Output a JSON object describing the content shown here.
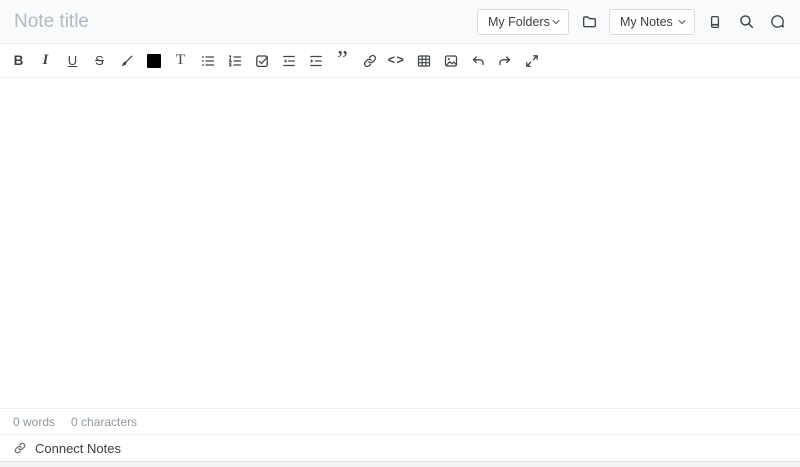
{
  "header": {
    "title_placeholder": "Note title",
    "folders_select": {
      "value": "My Folders"
    },
    "notes_select": {
      "value": "My Notes"
    },
    "icons": [
      "folder-icon",
      "notebook-icon",
      "search-icon",
      "chat-icon"
    ]
  },
  "toolbar": {
    "swatch_color": "#000000",
    "items": [
      {
        "name": "bold",
        "glyph": "B"
      },
      {
        "name": "italic",
        "glyph": "I"
      },
      {
        "name": "underline",
        "glyph": "U"
      },
      {
        "name": "strikethrough",
        "glyph": "S"
      },
      {
        "name": "highlighter-pen"
      },
      {
        "name": "text-color-swatch"
      },
      {
        "name": "font",
        "glyph": "T"
      },
      {
        "name": "bullet-list"
      },
      {
        "name": "ordered-list"
      },
      {
        "name": "task-list"
      },
      {
        "name": "outdent"
      },
      {
        "name": "indent"
      },
      {
        "name": "quote",
        "glyph": "”"
      },
      {
        "name": "link"
      },
      {
        "name": "code",
        "glyph": "<>"
      },
      {
        "name": "table"
      },
      {
        "name": "image"
      },
      {
        "name": "undo"
      },
      {
        "name": "redo"
      },
      {
        "name": "fullscreen"
      }
    ]
  },
  "status_bar": {
    "words": "0 words",
    "characters": "0 characters"
  },
  "connect_bar": {
    "label": "Connect Notes"
  },
  "colors": {
    "icon": "#3f4449",
    "muted_text": "#8f979f",
    "border": "#e8eaec",
    "header_bg": "#fafbfc",
    "swatch": "#000000"
  }
}
